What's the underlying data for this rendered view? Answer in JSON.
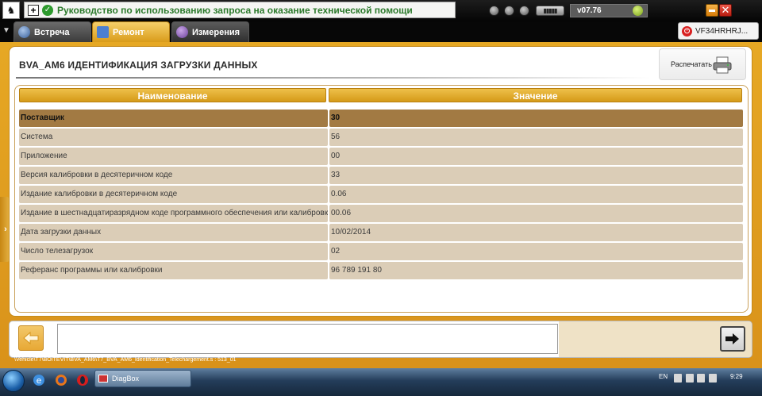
{
  "window": {
    "title": "Руководство по использованию запроса на оказание технической помощи",
    "version": "v07.76",
    "battery_label": "▮▮▮▮▮"
  },
  "tabs": [
    {
      "label": "Встреча"
    },
    {
      "label": "Ремонт"
    },
    {
      "label": "Измерения"
    }
  ],
  "vin": {
    "text": "VF34HRHRJ..."
  },
  "page": {
    "title": "BVA_AM6  ИДЕНТИФИКАЦИЯ ЗАГРУЗКИ ДАННЫХ",
    "print_label": "Распечатать"
  },
  "table": {
    "headers": {
      "name": "Наименование",
      "value": "Значение"
    },
    "rows": [
      {
        "name": "Поставщик",
        "value": "30"
      },
      {
        "name": "Система",
        "value": "56"
      },
      {
        "name": "Приложение",
        "value": "00"
      },
      {
        "name": "Версия калибровки в десятеричном коде",
        "value": "33"
      },
      {
        "name": "Издание калибровки в десятеричном коде",
        "value": "0.06"
      },
      {
        "name": "Издание в шестнадцатиразрядном коде программного обеспечения или калибровки",
        "value": "00.06"
      },
      {
        "name": "Дата загрузки данных",
        "value": "10/02/2014"
      },
      {
        "name": "Число телезагрузок",
        "value": "02"
      },
      {
        "name": "Реферанс программы или калибровки",
        "value": "96 789 191 80"
      }
    ]
  },
  "status": {
    "path": "\\Vehicle\\T7\\BOITEVIT\\BVA_AM6\\T7_BVA_AM6_Identification_Telechargement.s : 513_01"
  },
  "taskbar": {
    "app_label": "DiagBox",
    "language": "EN",
    "clock": "9:29"
  },
  "colors": {
    "accent": "#e2a224",
    "row": "#dbcdb7",
    "row_selected": "#a27a43",
    "title_green": "#2c7a2c"
  },
  "icons": [
    "peugeot-logo-icon",
    "plus-icon",
    "check-icon",
    "printer-icon",
    "back-arrow-icon",
    "next-arrow-icon",
    "power-icon",
    "chevron-right-icon"
  ]
}
